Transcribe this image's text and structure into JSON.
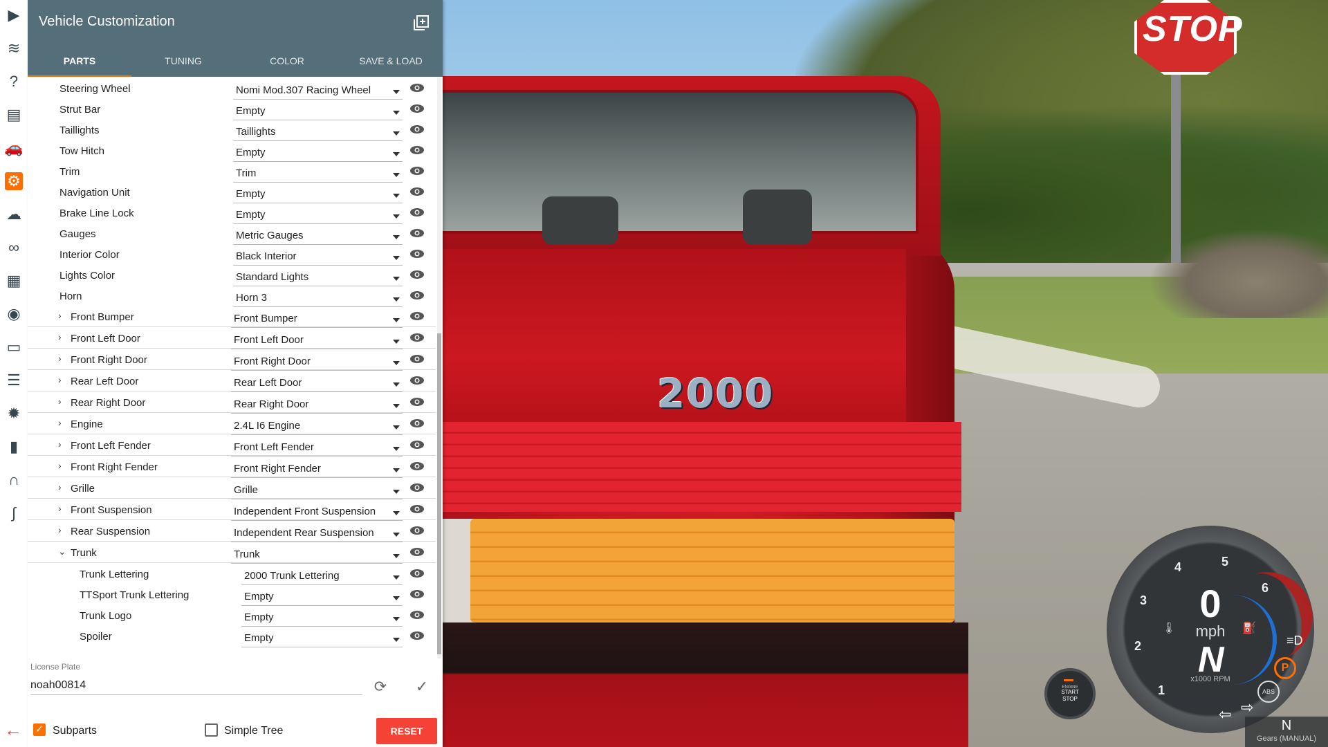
{
  "colors": {
    "header_bg": "#546e7a",
    "accent": "#ff6f00",
    "reset_red": "#f44336",
    "car_red": "#c9161f"
  },
  "sidebar_icons": [
    {
      "name": "play-icon",
      "glyph": "▶"
    },
    {
      "name": "layers-icon",
      "glyph": "≋"
    },
    {
      "name": "help-icon",
      "glyph": "?"
    },
    {
      "name": "scenario-icon",
      "glyph": "▤"
    },
    {
      "name": "car-icon",
      "glyph": "🚗"
    },
    {
      "name": "vehicle-config-icon",
      "glyph": "⚙"
    },
    {
      "name": "cloud-icon",
      "glyph": "☁"
    },
    {
      "name": "infinity-icon",
      "glyph": "∞"
    },
    {
      "name": "film-icon",
      "glyph": "▦"
    },
    {
      "name": "camera-icon",
      "glyph": "◉"
    },
    {
      "name": "screen-icon",
      "glyph": "▭"
    },
    {
      "name": "sliders-icon",
      "glyph": "☰"
    },
    {
      "name": "bug-icon",
      "glyph": "✹"
    },
    {
      "name": "bar-chart-icon",
      "glyph": "▮"
    },
    {
      "name": "headphones-icon",
      "glyph": "∩"
    },
    {
      "name": "signature-icon",
      "glyph": "∫"
    }
  ],
  "panel": {
    "title": "Vehicle Customization",
    "tabs": [
      "PARTS",
      "TUNING",
      "COLOR",
      "SAVE & LOAD"
    ]
  },
  "parts": [
    {
      "label": "Steering Wheel",
      "value": "Nomi Mod.307 Racing Wheel",
      "level": 0
    },
    {
      "label": "Strut Bar",
      "value": "Empty",
      "level": 0
    },
    {
      "label": "Taillights",
      "value": "Taillights",
      "level": 0
    },
    {
      "label": "Tow Hitch",
      "value": "Empty",
      "level": 0
    },
    {
      "label": "Trim",
      "value": "Trim",
      "level": 0
    },
    {
      "label": "Navigation Unit",
      "value": "Empty",
      "level": 0
    },
    {
      "label": "Brake Line Lock",
      "value": "Empty",
      "level": 0
    },
    {
      "label": "Gauges",
      "value": "Metric Gauges",
      "level": 0
    },
    {
      "label": "Interior Color",
      "value": "Black Interior",
      "level": 0
    },
    {
      "label": "Lights Color",
      "value": "Standard Lights",
      "level": 0
    },
    {
      "label": "Horn",
      "value": "Horn 3",
      "level": 0
    },
    {
      "label": "Front Bumper",
      "value": "Front Bumper",
      "level": 1,
      "expandable": true
    },
    {
      "label": "Front Left Door",
      "value": "Front Left Door",
      "level": 1,
      "expandable": true
    },
    {
      "label": "Front Right Door",
      "value": "Front Right Door",
      "level": 1,
      "expandable": true
    },
    {
      "label": "Rear Left Door",
      "value": "Rear Left Door",
      "level": 1,
      "expandable": true
    },
    {
      "label": "Rear Right Door",
      "value": "Rear Right Door",
      "level": 1,
      "expandable": true
    },
    {
      "label": "Engine",
      "value": "2.4L I6 Engine",
      "level": 1,
      "expandable": true
    },
    {
      "label": "Front Left Fender",
      "value": "Front Left Fender",
      "level": 1,
      "expandable": true
    },
    {
      "label": "Front Right Fender",
      "value": "Front Right Fender",
      "level": 1,
      "expandable": true
    },
    {
      "label": "Grille",
      "value": "Grille",
      "level": 1,
      "expandable": true
    },
    {
      "label": "Front Suspension",
      "value": "Independent Front Suspension",
      "level": 1,
      "expandable": true
    },
    {
      "label": "Rear Suspension",
      "value": "Independent Rear Suspension",
      "level": 1,
      "expandable": true
    },
    {
      "label": "Trunk",
      "value": "Trunk",
      "level": 1,
      "expandable": true,
      "expanded": true
    },
    {
      "label": "Trunk Lettering",
      "value": "2000 Trunk Lettering",
      "level": 2
    },
    {
      "label": "TTSport Trunk Lettering",
      "value": "Empty",
      "level": 2
    },
    {
      "label": "Trunk Logo",
      "value": "Empty",
      "level": 2
    },
    {
      "label": "Spoiler",
      "value": "Empty",
      "level": 2
    }
  ],
  "license_plate": {
    "label": "License Plate",
    "value": "noah00814"
  },
  "footer": {
    "subparts_label": "Subparts",
    "subparts_checked": true,
    "simple_tree_label": "Simple Tree",
    "simple_tree_checked": false,
    "reset_label": "RESET"
  },
  "scene": {
    "stop_sign": "STOP",
    "trunk_badge": "2000"
  },
  "dashboard": {
    "speed": "0",
    "speed_unit": "mph",
    "gear_display": "N",
    "rpm_label": "x1000 RPM",
    "rpm_ticks": [
      "1",
      "2",
      "3",
      "4",
      "5",
      "6"
    ],
    "engine_button_line1": "ENGINE",
    "engine_button_line2": "START",
    "engine_button_line3": "STOP",
    "parking_indicator": "P",
    "abs_indicator": "ABS",
    "gear": "N",
    "gear_mode": "Gears (MANUAL)"
  }
}
